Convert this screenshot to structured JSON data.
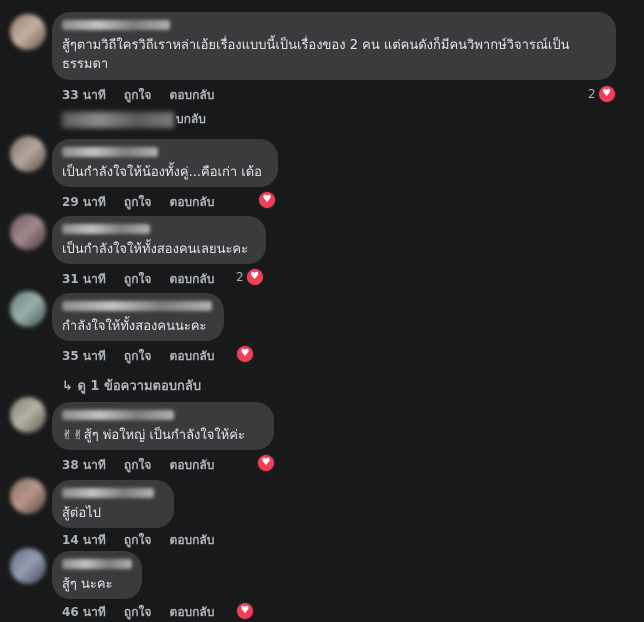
{
  "colors": {
    "background": "#18191a",
    "bubble": "#3a3b3c",
    "text": "#e4e6eb",
    "muted": "#b0b3b8",
    "heart": "#f33e58"
  },
  "comments": [
    {
      "text": "สู้ๆตามวิถีใครวิถีเราหล่าเอ้ยเรื่องแบบนี้เป็นเรื่องของ 2 คน แต่คนดังก็มีคนวิพากษ์วิจารณ์เป็น\nธรรมดา",
      "time": "33 นาที",
      "like": "ถูกใจ",
      "reply": "ตอบกลับ",
      "reaction_count": "2",
      "reaction_icon": "heart-icon"
    },
    {
      "text": "เป็นกำลังใจให้น้องทั้งคู่...คือเก่า เด้อ",
      "time": "29 นาที",
      "like": "ถูกใจ",
      "reply": "ตอบกลับ",
      "reaction_count": "",
      "reaction_icon": "heart-icon"
    },
    {
      "text": "เป็นกำลังใจให้ทั้งสองคนเลยนะคะ",
      "time": "31 นาที",
      "like": "ถูกใจ",
      "reply": "ตอบกลับ",
      "reaction_count": "2",
      "reaction_icon": "heart-icon"
    },
    {
      "text": "กำลังใจให้ทั้งสองคนนะคะ",
      "time": "35 นาที",
      "like": "ถูกใจ",
      "reply": "ตอบกลับ",
      "reaction_count": "",
      "reaction_icon": "heart-icon"
    },
    {
      "text": "✌✌สู้ๆ พ่อใหญ่ เป็นกำลังใจให้ค่ะ",
      "time": "38 นาที",
      "like": "ถูกใจ",
      "reply": "ตอบกลับ",
      "reaction_count": "",
      "reaction_icon": "heart-icon"
    },
    {
      "text": "สู้ต่อไป",
      "time": "14 นาที",
      "like": "ถูกใจ",
      "reply": "ตอบกลับ",
      "reaction_count": "",
      "reaction_icon": ""
    },
    {
      "text": "สู้ๆ นะคะ",
      "time": "46 นาที",
      "like": "ถูกใจ",
      "reply": "ตอบกลับ",
      "reaction_count": "",
      "reaction_icon": "heart-icon"
    }
  ],
  "reply_preview_label": "บกลับ",
  "view_replies": {
    "arrow": "↳",
    "label": "ดู 1 ข้อความตอบกลับ"
  }
}
